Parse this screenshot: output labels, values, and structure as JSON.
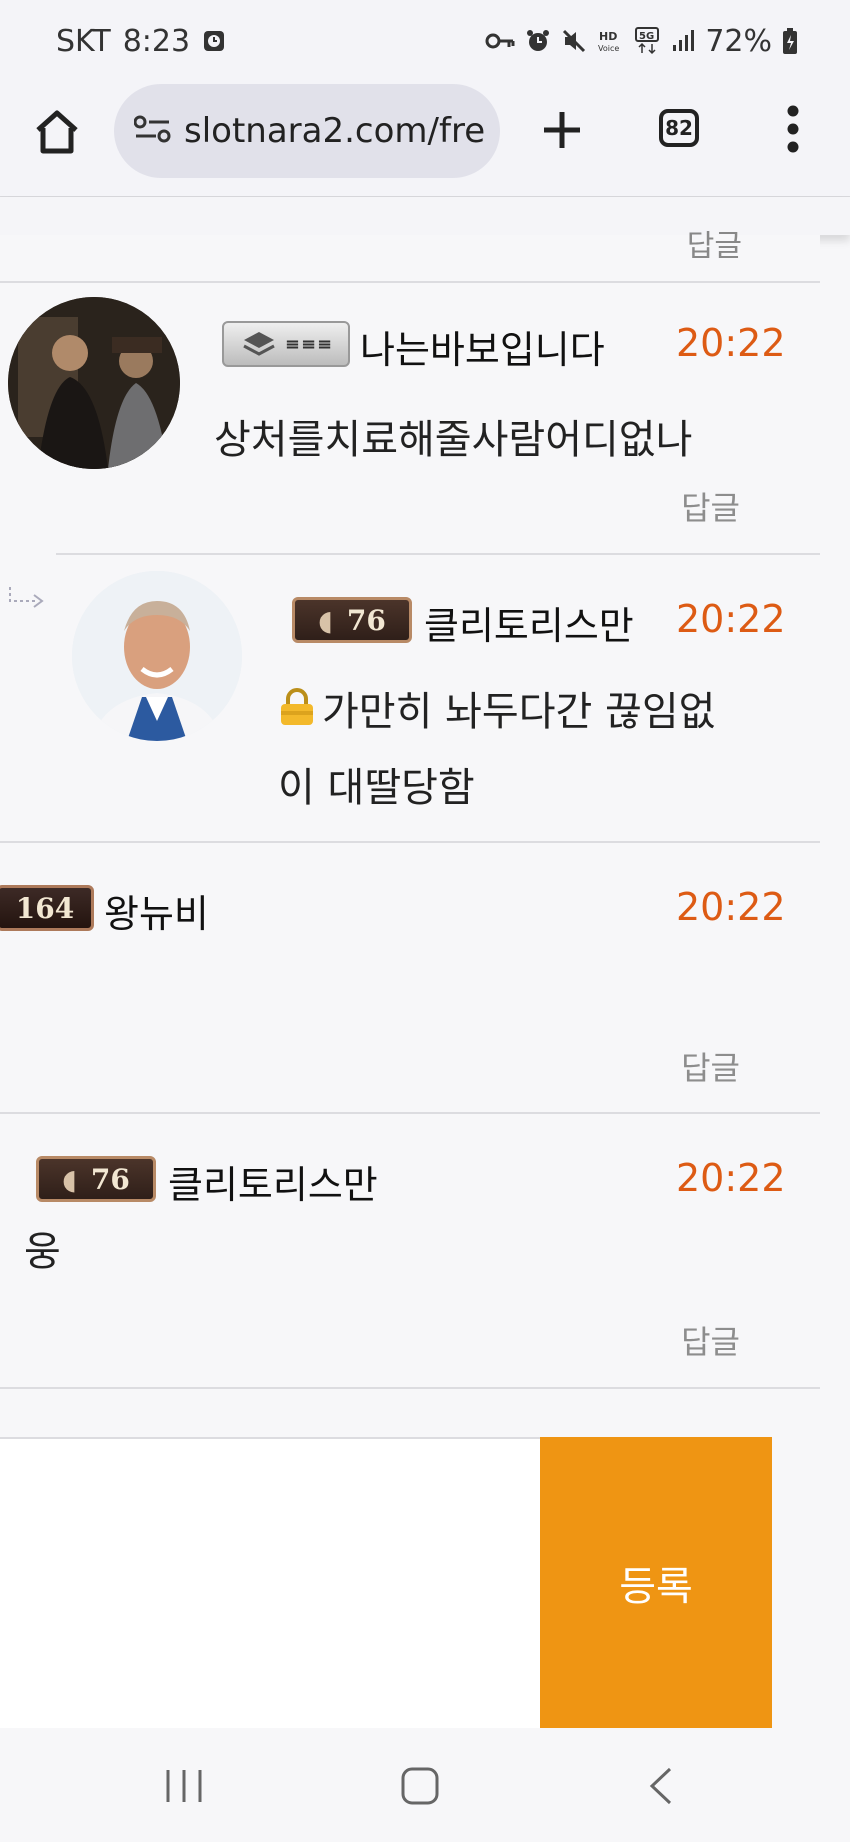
{
  "status_bar": {
    "carrier": "SKT",
    "time": "8:23",
    "battery": "72%",
    "icons": [
      "clock-icon",
      "key-icon",
      "alarm-icon",
      "mute-icon",
      "hd-voice-icon",
      "5g-icon",
      "signal-icon",
      "battery-icon"
    ]
  },
  "browser": {
    "url": "slotnara2.com/fre",
    "tab_count": "82"
  },
  "comments": [
    {
      "username": "나는바보입니다",
      "time": "20:22",
      "text": "상처를치료해줄사람어디없나",
      "reply": "답글",
      "badge": ""
    },
    {
      "username": "클리토리스만",
      "time": "20:22",
      "text": "가만히 놔두다간 끊임없이 대딸당함",
      "badge": "76"
    },
    {
      "username": "왕뉴비",
      "time": "20:22",
      "text": "",
      "reply": "답글",
      "badge": "164"
    },
    {
      "username": "클리토리스만",
      "time": "20:22",
      "text": "웅",
      "reply": "답글",
      "badge": "76"
    }
  ],
  "top_partial_reply": "답글",
  "form": {
    "submit_label": "등록"
  },
  "colors": {
    "accent": "#ef9513",
    "time": "#dd5b14"
  }
}
